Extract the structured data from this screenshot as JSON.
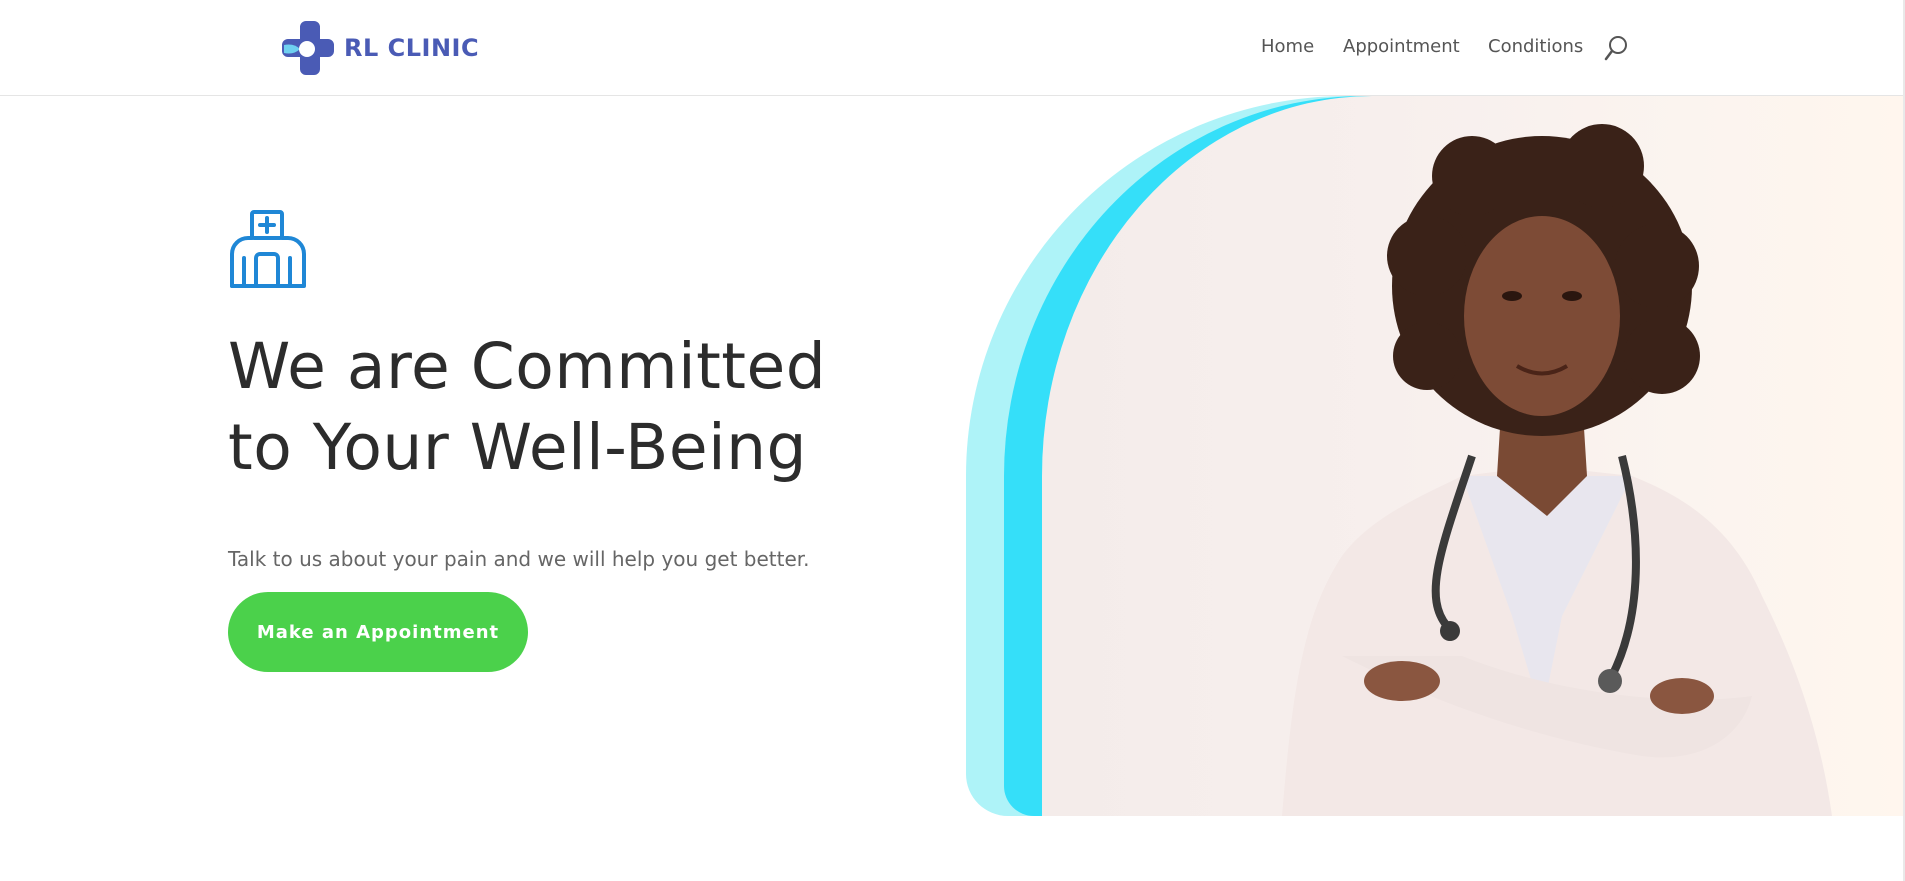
{
  "brand": {
    "name": "RL CLINIC",
    "logo_icon": "medical-cross-icon",
    "color": "#4a5bb5"
  },
  "nav": {
    "items": [
      {
        "label": "Home"
      },
      {
        "label": "Appointment"
      },
      {
        "label": "Conditions"
      }
    ],
    "search_icon": "search-icon"
  },
  "hero": {
    "icon": "hospital-icon",
    "title_line1": "We are Committed",
    "title_line2": "to Your Well-Being",
    "subtitle": "Talk to us about your pain and we will help you get better.",
    "cta_label": "Make an Appointment",
    "cta_color": "#4bd14b",
    "accent_light": "#aef3f8",
    "accent": "#35dff9"
  }
}
